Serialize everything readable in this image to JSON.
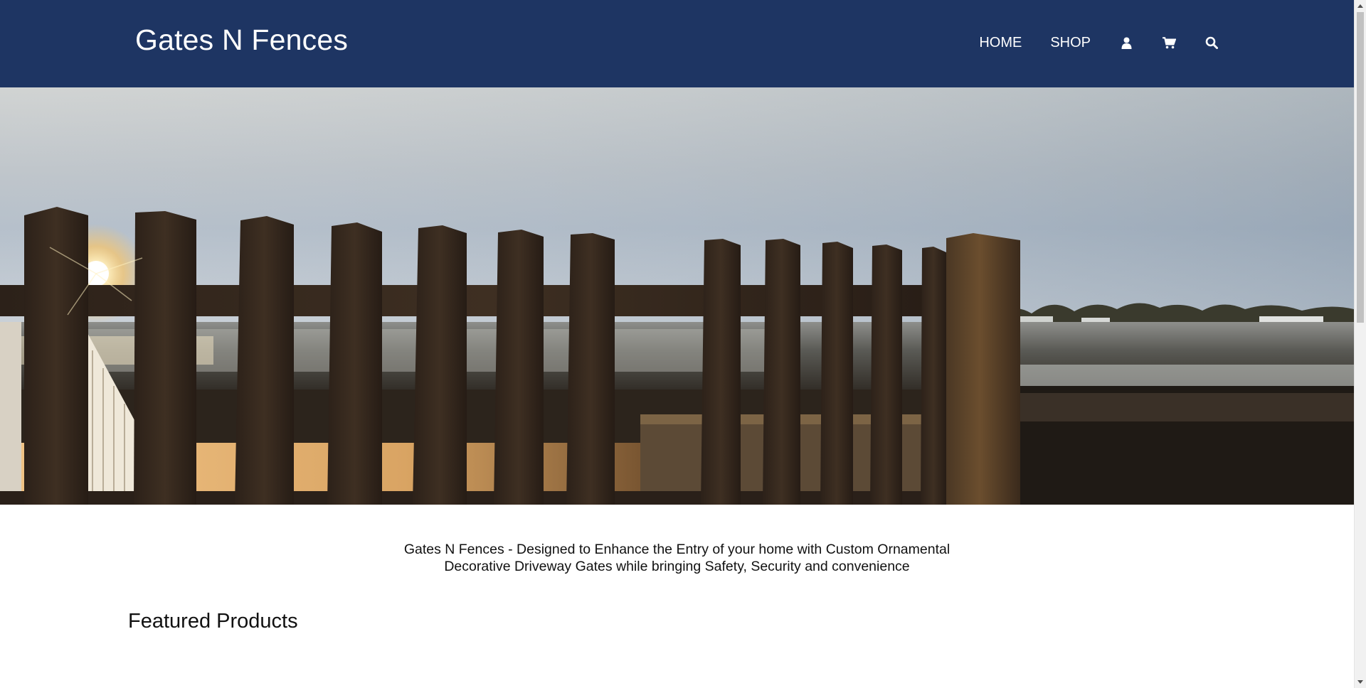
{
  "header": {
    "brand": "Gates N Fences",
    "nav": {
      "home": "HOME",
      "shop": "SHOP"
    },
    "icons": [
      "user-icon",
      "cart-icon",
      "search-icon"
    ],
    "background": "#1e3563"
  },
  "main": {
    "tagline_line1": "Gates N Fences - Designed to Enhance the Entry of your home with Custom Ornamental",
    "tagline_line2": "Decorative Driveway Gates while bringing Safety, Security and convenience",
    "featured_title": "Featured Products"
  },
  "hero": {
    "image": "fence-sunset-photo"
  }
}
